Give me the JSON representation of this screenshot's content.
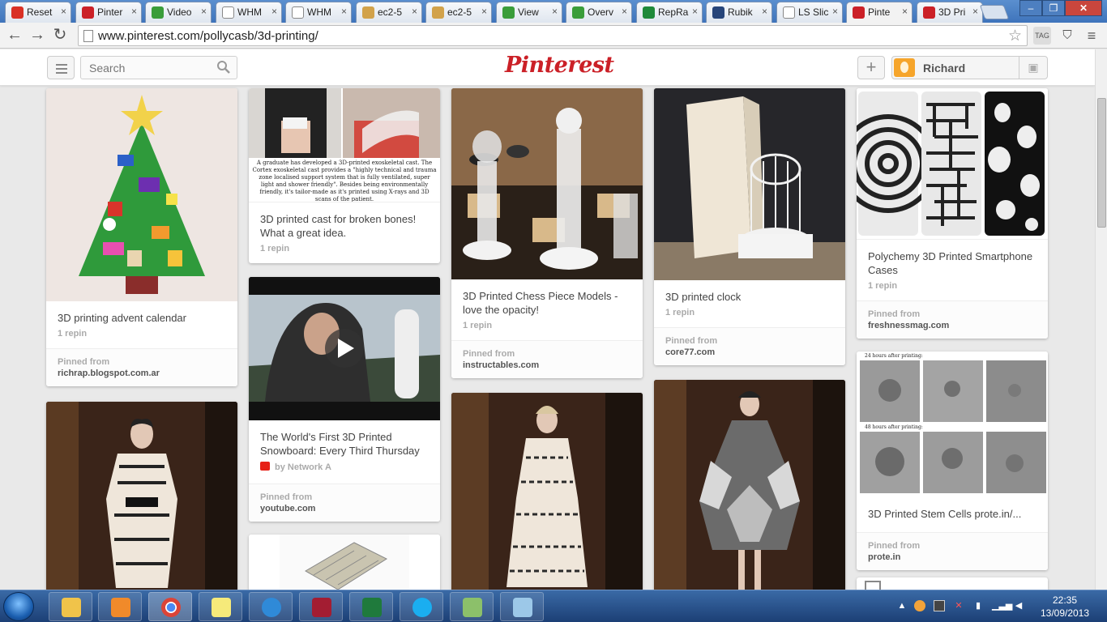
{
  "browser": {
    "tabs": [
      {
        "label": "Reset",
        "favicon_color": "#d93025",
        "favicon": "gmail-icon"
      },
      {
        "label": "Pinter",
        "favicon_color": "#cb2027",
        "favicon": "pinterest-icon"
      },
      {
        "label": "Video",
        "favicon_color": "#3a9d3a",
        "favicon": "gear-icon"
      },
      {
        "label": "WHM",
        "favicon_color": "#ffffff",
        "favicon": "page-icon"
      },
      {
        "label": "WHM",
        "favicon_color": "#ffffff",
        "favicon": "page-icon"
      },
      {
        "label": "ec2-5",
        "favicon_color": "#d2a24a",
        "favicon": "pma-icon"
      },
      {
        "label": "ec2-5",
        "favicon_color": "#d2a24a",
        "favicon": "pma-icon"
      },
      {
        "label": "View",
        "favicon_color": "#3a9d3a",
        "favicon": "gear-icon"
      },
      {
        "label": "Overv",
        "favicon_color": "#3a9d3a",
        "favicon": "gear-icon"
      },
      {
        "label": "RepRa",
        "favicon_color": "#1f8a3a",
        "favicon": "reprap-icon"
      },
      {
        "label": "Rubik",
        "favicon_color": "#27457a",
        "favicon": "rubik-icon"
      },
      {
        "label": "LS Slic",
        "favicon_color": "#ffffff",
        "favicon": "page-icon"
      },
      {
        "label": "Pinte",
        "favicon_color": "#cb2027",
        "favicon": "pinterest-icon",
        "active": true
      },
      {
        "label": "3D Pri",
        "favicon_color": "#cb2027",
        "favicon": "pinterest-icon"
      }
    ],
    "url": "www.pinterest.com/pollycasb/3d-printing/"
  },
  "header": {
    "search_placeholder": "Search",
    "logo": "Pinterest",
    "logo_color": "#cb2027",
    "user_name": "Richard"
  },
  "pins": [
    {
      "desc": "3D printing advent calendar",
      "repins": "1 repin",
      "from_label": "Pinned from",
      "source": "richrap.blogspot.com.ar"
    },
    {
      "desc": "3D printed cast for broken bones! What a great idea.",
      "repins": "1 repin",
      "caption": "A graduate has developed a 3D-printed exoskeletal cast. The Cortex exoskeletal cast provides a \"highly technical and trauma zone localised support system that is fully ventilated, super light and shower friendly\". Besides being environmentally friendly, it's tailor-made as it's printed using X-rays and 3D scans of the patient."
    },
    {
      "desc": "The World's First 3D Printed Snowboard: Every Third Thursday",
      "by": "by Network A",
      "from_label": "Pinned from",
      "source": "youtube.com"
    },
    {
      "desc": "3D Printed Chess Piece Models - love the opacity!",
      "repins": "1 repin",
      "from_label": "Pinned from",
      "source": "instructables.com"
    },
    {
      "desc": "3D printed clock",
      "repins": "1 repin",
      "from_label": "Pinned from",
      "source": "core77.com"
    },
    {
      "desc": "Polychemy 3D Printed Smartphone Cases",
      "repins": "1 repin",
      "from_label": "Pinned from",
      "source": "freshnessmag.com"
    },
    {
      "desc": "3D Printed Stem Cells prote.in/...",
      "from_label": "Pinned from",
      "source": "prote.in",
      "fig_top": "24 hours after printing:",
      "fig_bottom": "48 hours after printing:"
    }
  ],
  "taskbar": {
    "time": "22:35",
    "date": "13/09/2013"
  }
}
